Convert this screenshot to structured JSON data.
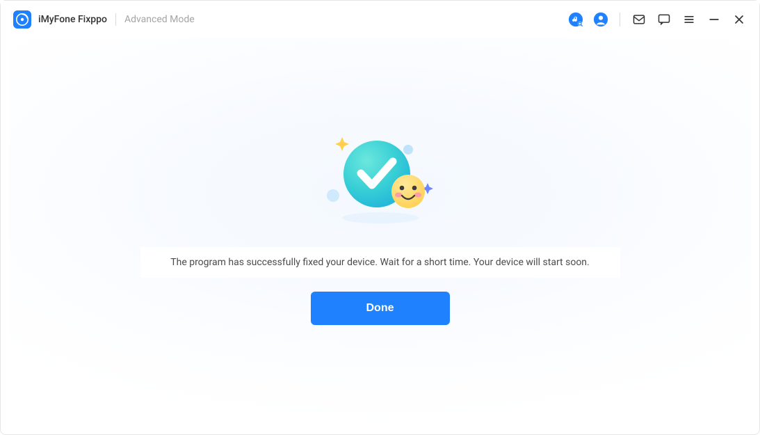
{
  "header": {
    "app_title": "iMyFone Fixppo",
    "mode_label": "Advanced Mode",
    "icons": {
      "music": "music-search-icon",
      "account": "account-icon",
      "mail": "mail-icon",
      "chat": "chat-icon",
      "menu": "menu-icon",
      "minimize": "minimize-icon",
      "close": "close-icon"
    }
  },
  "main": {
    "status_message": "The program has successfully fixed your device. Wait for a short time. Your device will start soon.",
    "done_label": "Done",
    "status": "success"
  },
  "colors": {
    "accent": "#2081ff",
    "check_gradient_from": "#48d8d4",
    "check_gradient_to": "#2ab4da"
  }
}
